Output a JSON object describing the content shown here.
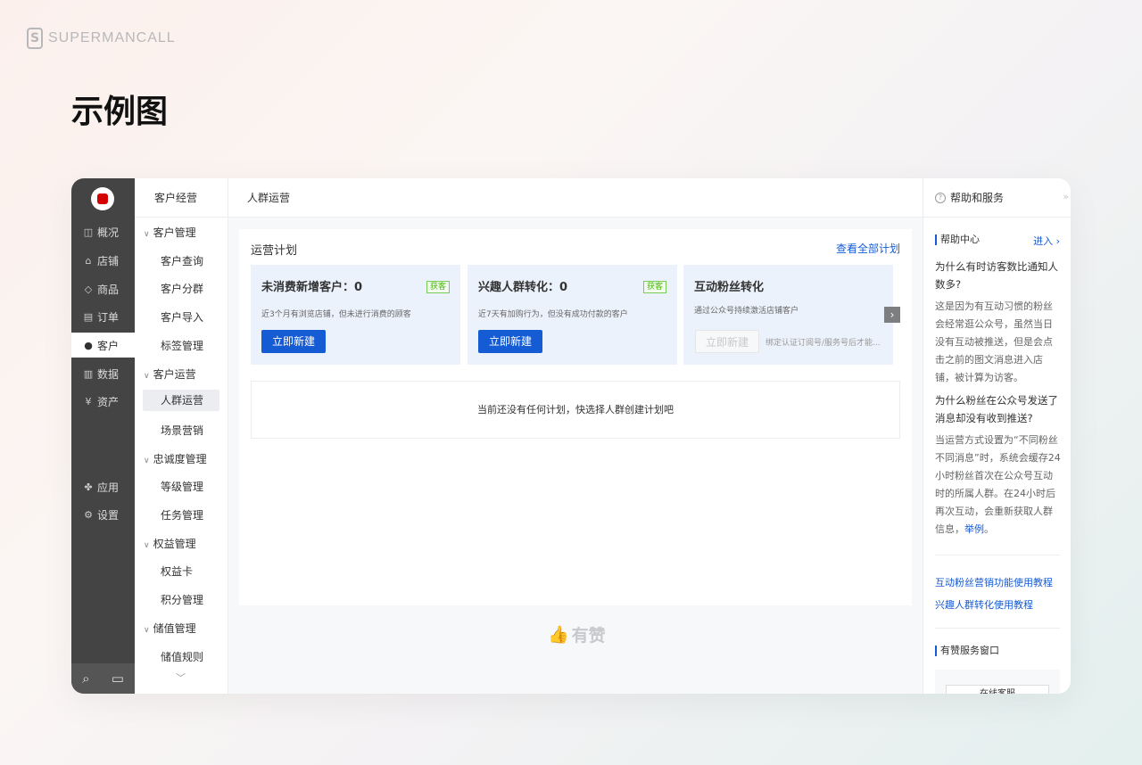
{
  "brand": {
    "name": "SUPERMANCALL",
    "logo_letter": "S"
  },
  "page_title": "示例图",
  "nav_primary": {
    "items": [
      {
        "label": "概况",
        "icon": "monitor-icon",
        "glyph": "◫"
      },
      {
        "label": "店铺",
        "icon": "store-icon",
        "glyph": "⌂"
      },
      {
        "label": "商品",
        "icon": "tag-icon",
        "glyph": "◇"
      },
      {
        "label": "订单",
        "icon": "order-icon",
        "glyph": "▤"
      },
      {
        "label": "客户",
        "icon": "user-icon",
        "glyph": "●"
      },
      {
        "label": "数据",
        "icon": "chart-icon",
        "glyph": "▥"
      },
      {
        "label": "资产",
        "icon": "yen-icon",
        "glyph": "¥"
      },
      {
        "label": "应用",
        "icon": "apps-icon",
        "glyph": "✤"
      },
      {
        "label": "设置",
        "icon": "gear-icon",
        "glyph": "⚙"
      }
    ],
    "active": "客户"
  },
  "nav_secondary": {
    "header": "客户经营",
    "groups": [
      {
        "label": "客户管理",
        "items": [
          "客户查询",
          "客户分群",
          "客户导入",
          "标签管理"
        ]
      },
      {
        "label": "客户运营",
        "items": [
          "人群运营",
          "场景营销"
        ]
      },
      {
        "label": "忠诚度管理",
        "items": [
          "等级管理",
          "任务管理"
        ]
      },
      {
        "label": "权益管理",
        "items": [
          "权益卡",
          "积分管理"
        ]
      },
      {
        "label": "储值管理",
        "items": [
          "储值规则"
        ]
      }
    ],
    "active": "人群运营"
  },
  "main": {
    "breadcrumb": "人群运营",
    "section_title": "运营计划",
    "view_all_link": "查看全部计划",
    "cards": [
      {
        "title": "未消费新增客户：0",
        "tag": "获客",
        "desc": "近3个月有浏览店铺，但未进行消费的顾客",
        "button": "立即新建"
      },
      {
        "title": "兴趣人群转化：0",
        "tag": "获客",
        "desc": "近7天有加购行为，但没有成功付款的客户",
        "button": "立即新建"
      },
      {
        "title": "互动粉丝转化",
        "tag": "",
        "desc": "通过公众号持续激活店铺客户",
        "button": "立即新建",
        "hint": "绑定认证订阅号/服务号后才能..."
      }
    ],
    "empty_text": "当前还没有任何计划，快选择人群创建计划吧",
    "footer_brand": "有赞"
  },
  "help": {
    "title": "帮助和服务",
    "help_center": "帮助中心",
    "enter": "进入",
    "q1_title": "为什么有时访客数比通知人数多?",
    "q1_body": "这是因为有互动习惯的粉丝会经常逛公众号，虽然当日没有互动被推送，但是会点击之前的图文消息进入店铺，被计算为访客。",
    "q2_title": "为什么粉丝在公众号发送了消息却没有收到推送?",
    "q2_body": "当运营方式设置为“不同粉丝不同消息”时，系统会缓存24小时粉丝首次在公众号互动时的所属人群。在24小时后再次互动，会重新获取人群信息，",
    "q2_link": "举例",
    "q2_end": "。",
    "tutorials": [
      "互动粉丝营销功能使用教程",
      "兴趣人群转化使用教程"
    ],
    "service_title": "有赞服务窗口",
    "online_service": "在线客服"
  }
}
